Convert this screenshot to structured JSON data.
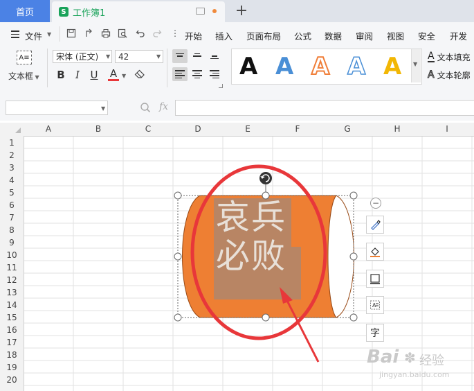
{
  "tabs": {
    "home": "首页",
    "doc": "工作簿1",
    "doc_icon": "S"
  },
  "menu": {
    "file": "文件",
    "items": [
      "开始",
      "插入",
      "页面布局",
      "公式",
      "数据",
      "审阅",
      "视图",
      "安全",
      "开发工"
    ]
  },
  "ribbon": {
    "textbox_label": "文本框",
    "font_name": "宋体 (正文)",
    "font_size": "42",
    "bold": "B",
    "italic": "I",
    "underline": "U",
    "font_color": "A",
    "style_glyph": "A",
    "text_fill": "文本填充",
    "text_outline": "文本轮廓"
  },
  "formula": {
    "fx": "fx"
  },
  "columns": [
    "A",
    "B",
    "C",
    "D",
    "E",
    "F",
    "G",
    "H",
    "I"
  ],
  "rows": [
    "1",
    "2",
    "3",
    "4",
    "5",
    "6",
    "7",
    "8",
    "9",
    "10",
    "11",
    "12",
    "13",
    "14",
    "15",
    "16",
    "17",
    "18",
    "19",
    "20"
  ],
  "shape": {
    "line1": "哀兵",
    "line2": "必败"
  },
  "side_tools": {
    "text_tool": "字"
  },
  "watermark": {
    "brand": "Bai",
    "brand2": "经验",
    "url": "jingyan.baidu.com"
  },
  "colors": {
    "accent_blue": "#4b82e5",
    "shape_orange": "#ee7f33",
    "annotation_red": "#e8373a",
    "wps_green": "#1aa35a"
  }
}
